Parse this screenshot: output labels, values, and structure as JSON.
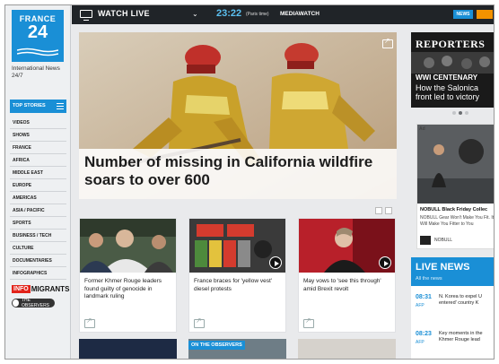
{
  "sidebar": {
    "logo_line1": "FRANCE",
    "logo_line2": "24",
    "tagline": "International News 24/7",
    "top_stories": "TOP STORIES",
    "nav": [
      "VIDEOS",
      "SHOWS",
      "FRANCE",
      "AFRICA",
      "MIDDLE EAST",
      "EUROPE",
      "AMERICAS",
      "ASIA / PACIFIC",
      "SPORTS",
      "BUSINESS / TECH",
      "CULTURE",
      "DOCUMENTARIES",
      "INFOGRAPHICS"
    ],
    "info_prefix": "INFO",
    "info_suffix": "MIGRANTS",
    "observers": "THE OBSERVERS"
  },
  "topbar": {
    "watch_live": "WATCH LIVE",
    "chevron": "⌄",
    "time": "23:22",
    "time_note": "(Paris time)",
    "channel": "MEDIAWATCH",
    "news_button": "NEWS"
  },
  "hero": {
    "title": "Number of missing in California wildfire soars to over 600"
  },
  "cards": [
    {
      "caption": "Former Khmer Rouge leaders found guilty of genocide in landmark ruling",
      "has_play": false
    },
    {
      "caption": "France braces for 'yellow vest' diesel protests",
      "has_play": true
    },
    {
      "caption": "May vows to 'see this through' amid Brexit revolt",
      "has_play": true
    }
  ],
  "bottom_row": {
    "observers_label": "ON THE OBSERVERS"
  },
  "reporters": {
    "logo": "REPORTERS",
    "headline": "WWI CENTENARY",
    "subtitle": "How the Salonica front led to victory"
  },
  "ad": {
    "tag": "Ad",
    "title": "NOBULL Black Friday Collec",
    "desc": "NOBULL Gear Won't Make You Fit. It Will Make You Fitter to You",
    "brand": "NOBULL"
  },
  "live_news": {
    "title": "LIVE NEWS",
    "subtitle": "All the news",
    "items": [
      {
        "time": "08:31",
        "source": "AFP",
        "text": "N. Korea to expel U entered' country K"
      },
      {
        "time": "08:23",
        "source": "AFP",
        "text": "Key moments in the Khmer Rouge lead"
      }
    ]
  },
  "colors": {
    "accent": "#1a8fd6",
    "topbar": "#202428",
    "clock": "#5bc0f0",
    "orange": "#f39200"
  }
}
